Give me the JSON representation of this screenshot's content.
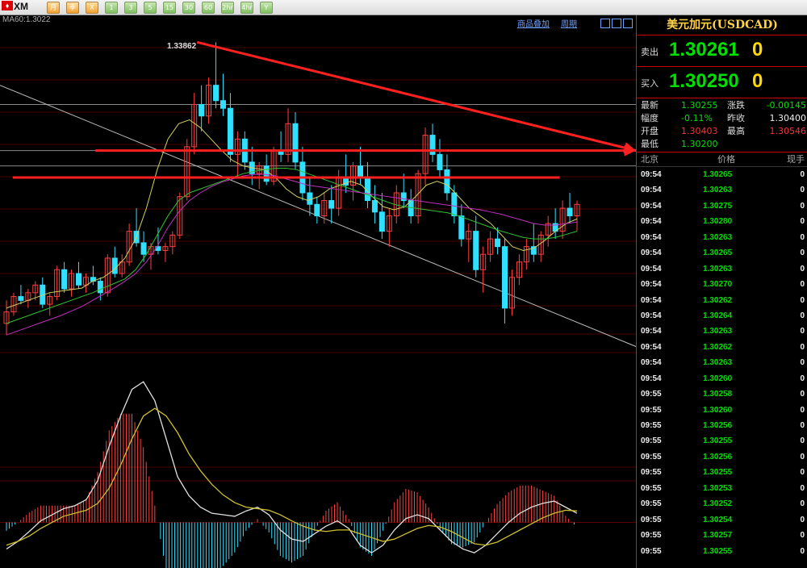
{
  "toolbar": {
    "logo": "XM",
    "buttons": [
      "月",
      "季",
      "X",
      "1",
      "3",
      "5",
      "15",
      "30",
      "60",
      "2hr",
      "4hr",
      "Y"
    ]
  },
  "chart_labels": {
    "ma_label": "MA60:1.3022",
    "peak_label": "1.33862",
    "links": [
      "商品叠加",
      "周期"
    ]
  },
  "panel": {
    "title": "美元加元(USDCAD)",
    "sell_label": "卖出",
    "sell_price": "1.30261",
    "sell_lot": "0",
    "buy_label": "买入",
    "buy_price": "1.30250",
    "buy_lot": "0",
    "stats": [
      {
        "label": "最新",
        "value": "1.30255",
        "vcolor": "#00e000"
      },
      {
        "label": "涨跌",
        "value": "-0.00145",
        "vcolor": "#00e000"
      },
      {
        "label": "幅度",
        "value": "-0.11%",
        "vcolor": "#00e000"
      },
      {
        "label": "昨收",
        "value": "1.30400",
        "vcolor": "#eeeeee"
      },
      {
        "label": "开盘",
        "value": "1.30403",
        "vcolor": "#ff3030"
      },
      {
        "label": "最高",
        "value": "1.30546",
        "vcolor": "#ff3030"
      },
      {
        "label": "最低",
        "value": "1.30200",
        "vcolor": "#00e000"
      }
    ],
    "tick_headers": {
      "time": "北京",
      "price": "价格",
      "volume": "现手"
    },
    "ticks": [
      {
        "time": "09:54",
        "price": "1.30265",
        "vol": "0"
      },
      {
        "time": "09:54",
        "price": "1.30263",
        "vol": "0"
      },
      {
        "time": "09:54",
        "price": "1.30275",
        "vol": "0"
      },
      {
        "time": "09:54",
        "price": "1.30280",
        "vol": "0"
      },
      {
        "time": "09:54",
        "price": "1.30263",
        "vol": "0"
      },
      {
        "time": "09:54",
        "price": "1.30265",
        "vol": "0"
      },
      {
        "time": "09:54",
        "price": "1.30263",
        "vol": "0"
      },
      {
        "time": "09:54",
        "price": "1.30270",
        "vol": "0"
      },
      {
        "time": "09:54",
        "price": "1.30262",
        "vol": "0"
      },
      {
        "time": "09:54",
        "price": "1.30264",
        "vol": "0"
      },
      {
        "time": "09:54",
        "price": "1.30263",
        "vol": "0"
      },
      {
        "time": "09:54",
        "price": "1.30262",
        "vol": "0"
      },
      {
        "time": "09:54",
        "price": "1.30263",
        "vol": "0"
      },
      {
        "time": "09:54",
        "price": "1.30260",
        "vol": "0"
      },
      {
        "time": "09:55",
        "price": "1.30258",
        "vol": "0"
      },
      {
        "time": "09:55",
        "price": "1.30260",
        "vol": "0"
      },
      {
        "time": "09:55",
        "price": "1.30256",
        "vol": "0"
      },
      {
        "time": "09:55",
        "price": "1.30255",
        "vol": "0"
      },
      {
        "time": "09:55",
        "price": "1.30256",
        "vol": "0"
      },
      {
        "time": "09:55",
        "price": "1.30255",
        "vol": "0"
      },
      {
        "time": "09:55",
        "price": "1.30253",
        "vol": "0"
      },
      {
        "time": "09:55",
        "price": "1.30252",
        "vol": "0"
      },
      {
        "time": "09:55",
        "price": "1.30254",
        "vol": "0"
      },
      {
        "time": "09:55",
        "price": "1.30257",
        "vol": "0"
      },
      {
        "time": "09:55",
        "price": "1.30255",
        "vol": "0"
      }
    ]
  },
  "chart_data": {
    "type": "candlestick",
    "title": "",
    "xlabel": "",
    "ylabel": "",
    "ylim": [
      1.298,
      1.34
    ],
    "candles": [
      [
        1.302,
        1.305,
        1.3005,
        1.3035
      ],
      [
        1.3035,
        1.306,
        1.303,
        1.3055
      ],
      [
        1.3055,
        1.307,
        1.3045,
        1.305
      ],
      [
        1.305,
        1.3065,
        1.304,
        1.306
      ],
      [
        1.306,
        1.3075,
        1.305,
        1.307
      ],
      [
        1.307,
        1.308,
        1.304,
        1.3045
      ],
      [
        1.3045,
        1.306,
        1.303,
        1.3055
      ],
      [
        1.3055,
        1.3095,
        1.305,
        1.309
      ],
      [
        1.309,
        1.31,
        1.306,
        1.3065
      ],
      [
        1.3065,
        1.309,
        1.3055,
        1.3085
      ],
      [
        1.3085,
        1.31,
        1.3065,
        1.307
      ],
      [
        1.307,
        1.3085,
        1.306,
        1.308
      ],
      [
        1.308,
        1.3095,
        1.307,
        1.3075
      ],
      [
        1.3075,
        1.308,
        1.305,
        1.306
      ],
      [
        1.306,
        1.311,
        1.3055,
        1.3105
      ],
      [
        1.3105,
        1.312,
        1.308,
        1.3085
      ],
      [
        1.3085,
        1.311,
        1.308,
        1.31
      ],
      [
        1.31,
        1.315,
        1.3095,
        1.314
      ],
      [
        1.314,
        1.317,
        1.312,
        1.3125
      ],
      [
        1.3125,
        1.314,
        1.31,
        1.311
      ],
      [
        1.311,
        1.3125,
        1.309,
        1.312
      ],
      [
        1.312,
        1.3145,
        1.311,
        1.3115
      ],
      [
        1.3115,
        1.3125,
        1.31,
        1.312
      ],
      [
        1.312,
        1.314,
        1.311,
        1.3135
      ],
      [
        1.3135,
        1.319,
        1.313,
        1.3185
      ],
      [
        1.3185,
        1.326,
        1.318,
        1.325
      ],
      [
        1.325,
        1.332,
        1.324,
        1.3305
      ],
      [
        1.3305,
        1.333,
        1.327,
        1.329
      ],
      [
        1.329,
        1.334,
        1.328,
        1.333
      ],
      [
        1.333,
        1.3386,
        1.33,
        1.331
      ],
      [
        1.331,
        1.3345,
        1.329,
        1.33
      ],
      [
        1.33,
        1.332,
        1.323,
        1.324
      ],
      [
        1.324,
        1.327,
        1.321,
        1.326
      ],
      [
        1.326,
        1.327,
        1.322,
        1.323
      ],
      [
        1.323,
        1.325,
        1.32,
        1.3215
      ],
      [
        1.3215,
        1.323,
        1.3195,
        1.3225
      ],
      [
        1.3225,
        1.324,
        1.32,
        1.3205
      ],
      [
        1.3205,
        1.325,
        1.32,
        1.3245
      ],
      [
        1.3245,
        1.327,
        1.323,
        1.324
      ],
      [
        1.324,
        1.33,
        1.323,
        1.328
      ],
      [
        1.328,
        1.3295,
        1.322,
        1.323
      ],
      [
        1.323,
        1.325,
        1.318,
        1.319
      ],
      [
        1.319,
        1.321,
        1.316,
        1.3175
      ],
      [
        1.3175,
        1.3185,
        1.315,
        1.316
      ],
      [
        1.316,
        1.319,
        1.315,
        1.318
      ],
      [
        1.318,
        1.32,
        1.315,
        1.317
      ],
      [
        1.317,
        1.322,
        1.316,
        1.321
      ],
      [
        1.321,
        1.324,
        1.319,
        1.32
      ],
      [
        1.32,
        1.323,
        1.318,
        1.3225
      ],
      [
        1.3225,
        1.325,
        1.32,
        1.321
      ],
      [
        1.321,
        1.323,
        1.317,
        1.318
      ],
      [
        1.318,
        1.32,
        1.315,
        1.3165
      ],
      [
        1.3165,
        1.319,
        1.313,
        1.314
      ],
      [
        1.314,
        1.317,
        1.312,
        1.316
      ],
      [
        1.316,
        1.32,
        1.315,
        1.319
      ],
      [
        1.319,
        1.3215,
        1.317,
        1.318
      ],
      [
        1.318,
        1.3195,
        1.315,
        1.316
      ],
      [
        1.316,
        1.322,
        1.315,
        1.3215
      ],
      [
        1.3215,
        1.3275,
        1.32,
        1.3265
      ],
      [
        1.3265,
        1.328,
        1.323,
        1.324
      ],
      [
        1.324,
        1.326,
        1.321,
        1.322
      ],
      [
        1.322,
        1.324,
        1.318,
        1.319
      ],
      [
        1.319,
        1.32,
        1.315,
        1.316
      ],
      [
        1.316,
        1.3175,
        1.312,
        1.313
      ],
      [
        1.313,
        1.315,
        1.31,
        1.314
      ],
      [
        1.314,
        1.316,
        1.308,
        1.309
      ],
      [
        1.309,
        1.312,
        1.306,
        1.311
      ],
      [
        1.311,
        1.314,
        1.31,
        1.313
      ],
      [
        1.313,
        1.3145,
        1.311,
        1.312
      ],
      [
        1.312,
        1.313,
        1.302,
        1.304
      ],
      [
        1.304,
        1.309,
        1.303,
        1.308
      ],
      [
        1.308,
        1.311,
        1.307,
        1.31
      ],
      [
        1.31,
        1.313,
        1.309,
        1.312
      ],
      [
        1.312,
        1.315,
        1.31,
        1.311
      ],
      [
        1.311,
        1.314,
        1.31,
        1.3135
      ],
      [
        1.3135,
        1.316,
        1.312,
        1.315
      ],
      [
        1.315,
        1.317,
        1.313,
        1.314
      ],
      [
        1.314,
        1.318,
        1.313,
        1.317
      ],
      [
        1.317,
        1.319,
        1.315,
        1.316
      ],
      [
        1.316,
        1.318,
        1.314,
        1.3175
      ]
    ],
    "ma_lines": [
      {
        "color": "#d0d060",
        "values": [
          1.304,
          1.3045,
          1.305,
          1.3055,
          1.306,
          1.3062,
          1.3064,
          1.3066,
          1.3075,
          1.308,
          1.309,
          1.3105,
          1.313,
          1.317,
          1.322,
          1.326,
          1.328,
          1.3285,
          1.3275,
          1.326,
          1.3245,
          1.3232,
          1.3225,
          1.3222,
          1.322,
          1.321,
          1.3195,
          1.3185,
          1.318,
          1.3185,
          1.3195,
          1.32,
          1.3205,
          1.32,
          1.3185,
          1.3172,
          1.3168,
          1.3172,
          1.3185,
          1.32,
          1.3205,
          1.32,
          1.3185,
          1.317,
          1.316,
          1.315,
          1.3135,
          1.312,
          1.3115,
          1.3118,
          1.3128,
          1.314,
          1.315,
          1.3156
        ]
      },
      {
        "color": "#30c030",
        "values": [
          1.302,
          1.3025,
          1.303,
          1.3035,
          1.304,
          1.3045,
          1.305,
          1.3055,
          1.306,
          1.3066,
          1.3072,
          1.3078,
          1.309,
          1.311,
          1.3135,
          1.316,
          1.318,
          1.319,
          1.3195,
          1.32,
          1.3205,
          1.321,
          1.3215,
          1.3218,
          1.322,
          1.3222,
          1.3222,
          1.322,
          1.3215,
          1.321,
          1.3205,
          1.32,
          1.3195,
          1.319,
          1.3185,
          1.318,
          1.3175,
          1.3172,
          1.317,
          1.3168,
          1.3166,
          1.3164,
          1.316,
          1.3155,
          1.315,
          1.3145,
          1.314,
          1.3136,
          1.3132,
          1.313,
          1.313,
          1.3132,
          1.3136,
          1.314
        ]
      },
      {
        "color": "#c030c0",
        "values": [
          1.3005,
          1.301,
          1.3015,
          1.302,
          1.3025,
          1.303,
          1.3036,
          1.3042,
          1.305,
          1.3058,
          1.3066,
          1.3075,
          1.3085,
          1.31,
          1.312,
          1.3145,
          1.3165,
          1.318,
          1.319,
          1.3198,
          1.3204,
          1.3208,
          1.3212,
          1.3214,
          1.3214,
          1.3212,
          1.3208,
          1.3204,
          1.32,
          1.3198,
          1.3196,
          1.3194,
          1.3192,
          1.319,
          1.3188,
          1.3186,
          1.3184,
          1.3182,
          1.318,
          1.3178,
          1.3176,
          1.3174,
          1.3172,
          1.317,
          1.3168,
          1.3165,
          1.3162,
          1.3158,
          1.3154,
          1.315,
          1.3148,
          1.3148,
          1.315,
          1.3152
        ]
      }
    ],
    "macd": {
      "dif": [
        -0.0035,
        -0.0025,
        -0.0012,
        0.0002,
        0.001,
        0.0018,
        0.0022,
        0.003,
        0.0055,
        0.01,
        0.014,
        0.0175,
        0.0185,
        0.016,
        0.011,
        0.006,
        0.0035,
        0.002,
        0.0012,
        0.001,
        0.0008,
        0.0015,
        0.002,
        0.001,
        -0.001,
        -0.0022,
        -0.0025,
        -0.0015,
        -0.0005,
        0.0002,
        -0.0008,
        -0.003,
        -0.004,
        -0.003,
        -0.001,
        0.0005,
        0.001,
        0.0005,
        -0.001,
        -0.0025,
        -0.0035,
        -0.004,
        -0.003,
        -0.0015,
        0.0,
        0.0012,
        0.002,
        0.0025,
        0.0028,
        0.002,
        0.0012
      ],
      "dea": [
        -0.003,
        -0.0025,
        -0.0018,
        -0.0008,
        0.0,
        0.0008,
        0.0012,
        0.0016,
        0.0025,
        0.0045,
        0.0075,
        0.011,
        0.014,
        0.015,
        0.014,
        0.0118,
        0.009,
        0.0068,
        0.005,
        0.0036,
        0.0026,
        0.002,
        0.0018,
        0.0016,
        0.001,
        0.0002,
        -0.0005,
        -0.001,
        -0.0012,
        -0.001,
        -0.001,
        -0.0015,
        -0.002,
        -0.0025,
        -0.0022,
        -0.0015,
        -0.0008,
        -0.0004,
        -0.0006,
        -0.0012,
        -0.002,
        -0.0028,
        -0.003,
        -0.0026,
        -0.0018,
        -0.001,
        -0.0002,
        0.0006,
        0.0012,
        0.0016,
        0.0015
      ],
      "hist_ylim": [
        -0.006,
        0.02
      ]
    },
    "trend_lines": [
      {
        "color": "#ff2020",
        "from": [
          0.31,
          1.3386
        ],
        "to": [
          1.0,
          1.3245
        ],
        "style": "arrow"
      },
      {
        "color": "#ff2020",
        "from": [
          0.15,
          1.3245
        ],
        "to": [
          1.0,
          1.3245
        ],
        "style": "arrow"
      },
      {
        "color": "#ff2020",
        "from": [
          0.02,
          1.321
        ],
        "to": [
          0.88,
          1.321
        ],
        "style": "line"
      }
    ],
    "grid": true
  }
}
